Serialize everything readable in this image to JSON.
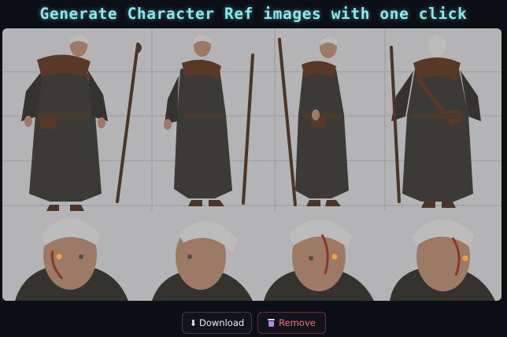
{
  "header": {
    "title": "Generate Character Ref images with one click"
  },
  "sheet": {
    "full_body_views": [
      "character-front-view",
      "character-three-quarter-left-view",
      "character-side-right-view",
      "character-back-view"
    ],
    "head_views": [
      "head-front-view",
      "head-side-view",
      "head-three-quarter-view",
      "head-three-quarter-right-view"
    ],
    "colors": {
      "background": "#b4b4b6",
      "robe": "#3b3a36",
      "leather": "#5a3826",
      "skin": "#9c7a66",
      "hair": "#bdbcbc",
      "eye_glow": "#f2a23a",
      "staff": "#4a3526"
    }
  },
  "actions": {
    "download": {
      "icon": "download-icon",
      "glyph": "⬇",
      "label": "Download",
      "color": "#e6e8ee"
    },
    "remove": {
      "icon": "trash-icon",
      "label": "Remove",
      "color": "#ff6b7a"
    }
  }
}
